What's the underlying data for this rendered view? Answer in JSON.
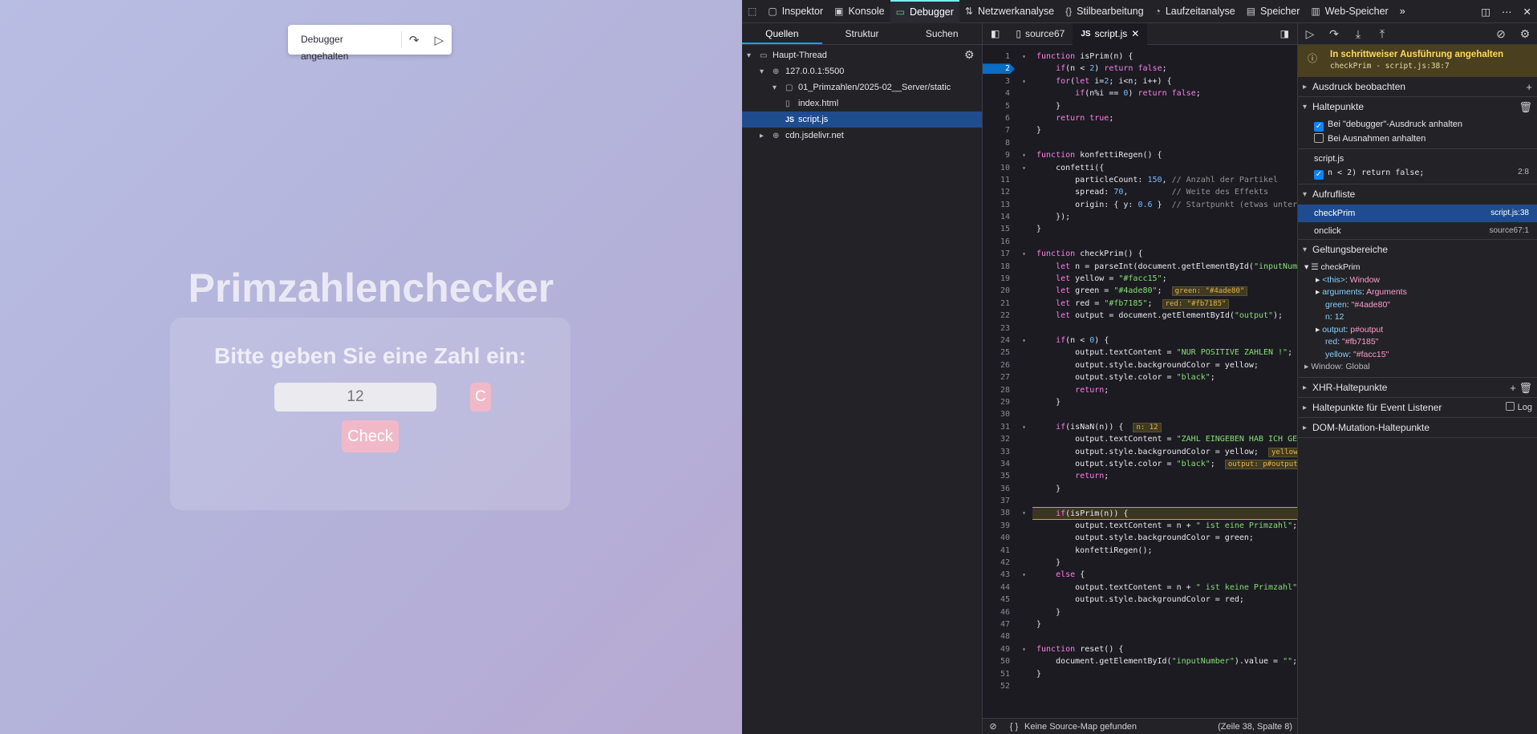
{
  "page": {
    "paused_overlay": {
      "label": "Debugger angehalten",
      "step_icon": "step-over-icon",
      "resume_icon": "resume-icon"
    },
    "title": "Primzahlenchecker",
    "prompt": "Bitte geben Sie eine Zahl ein:",
    "input_value": "12",
    "clear_label": "C",
    "check_label": "Check",
    "accent": "#f1b9c8"
  },
  "toolbar": {
    "tabs": [
      "Inspektor",
      "Konsole",
      "Debugger",
      "Netzwerkanalyse",
      "Stilbearbeitung",
      "Laufzeitanalyse",
      "Speicher",
      "Web-Speicher"
    ],
    "active": "Debugger"
  },
  "sources": {
    "tabs": [
      "Quellen",
      "Struktur",
      "Suchen"
    ],
    "tree": [
      "Haupt-Thread",
      "127.0.0.1:5500",
      "01_Primzahlen/2025-02__Server/static",
      "index.html",
      "script.js",
      "cdn.jsdelivr.net"
    ],
    "js_badge": "JS"
  },
  "editor": {
    "tabs": [
      "source67",
      "script.js"
    ],
    "footer_sourcemap": "Keine Source-Map gefunden",
    "footer_pos": "(Zeile 38, Spalte 8)",
    "lines": [
      "function isPrim(n) {",
      "    if(n < 2) return false;",
      "    for(let i=2; i<n; i++) {",
      "        if(n%i == 0) return false;",
      "    }",
      "    return true;",
      "}",
      "",
      "function konfettiRegen() {",
      "    confetti({",
      "        particleCount: 150, // Anzahl der Partikel",
      "        spread: 70,         // Weite des Effekts",
      "        origin: { y: 0.6 }  // Startpunkt (etwas unter",
      "    });",
      "}",
      "",
      "function checkPrim() {",
      "    let n = parseInt(document.getElementById(\"inputNum",
      "    let yellow = \"#facc15\";",
      "    let green = \"#4ade80\";",
      "    let red = \"#fb7185\";",
      "    let output = document.getElementById(\"output\");",
      "",
      "    if(n < 0) {",
      "        output.textContent = \"NUR POSITIVE ZAHLEN !\";",
      "        output.style.backgroundColor = yellow;",
      "        output.style.color = \"black\";",
      "        return;",
      "    }",
      "",
      "    if(isNaN(n)) {",
      "        output.textContent = \"ZAHL EINGEBEN HAB ICH GE",
      "        output.style.backgroundColor = yellow;",
      "        output.style.color = \"black\";",
      "        return;",
      "    }",
      "",
      "    if(isPrim(n)) {",
      "        output.textContent = n + \" ist eine Primzahl\";",
      "        output.style.backgroundColor = green;",
      "        konfettiRegen();",
      "    }",
      "    else {",
      "        output.textContent = n + \" ist keine Primzahl\"",
      "        output.style.backgroundColor = red;",
      "    }",
      "}",
      "",
      "function reset() {",
      "    document.getElementById(\"inputNumber\").value = \"\";",
      "}",
      ""
    ],
    "inline_previews": {
      "20": "green: \"#4ade80\"",
      "21": "red: \"#fb7185\"",
      "31": "n: 12",
      "33": "yellow",
      "34": "output: p#output"
    },
    "breakpoint_line": 2,
    "paused_line": 38
  },
  "debug_panel": {
    "pause_title": "In schrittweiser Ausführung angehalten",
    "pause_loc": "checkPrim - script.js:38:7",
    "sec_watch": "Ausdruck beobachten",
    "sec_breakpoints": "Haltepunkte",
    "opt_debugger": "Bei \"debugger\"-Ausdruck anhalten",
    "opt_exceptions": "Bei Ausnahmen anhalten",
    "bp_file": "script.js",
    "bp_code": "n < 2) return false;",
    "bp_loc": "2:8",
    "sec_callstack": "Aufrufliste",
    "stack": [
      {
        "name": "checkPrim",
        "loc": "script.js:38"
      },
      {
        "name": "onclick",
        "loc": "source67:1"
      }
    ],
    "sec_scopes": "Geltungsbereiche",
    "scope_fn": "checkPrim",
    "scope_vars": [
      {
        "k": "<this>",
        "v": "Window",
        "exp": true
      },
      {
        "k": "arguments",
        "v": "Arguments",
        "exp": true
      },
      {
        "k": "green",
        "v": "\"#4ade80\"",
        "exp": false
      },
      {
        "k": "n",
        "v": "12",
        "exp": false
      },
      {
        "k": "output",
        "v": "p#output",
        "exp": true
      },
      {
        "k": "red",
        "v": "\"#fb7185\"",
        "exp": false
      },
      {
        "k": "yellow",
        "v": "\"#facc15\"",
        "exp": false
      }
    ],
    "scope_global": "Window: Global",
    "sec_xhr": "XHR-Haltepunkte",
    "sec_event": "Haltepunkte für Event Listener",
    "event_log": "Log",
    "sec_dom": "DOM-Mutation-Haltepunkte"
  }
}
